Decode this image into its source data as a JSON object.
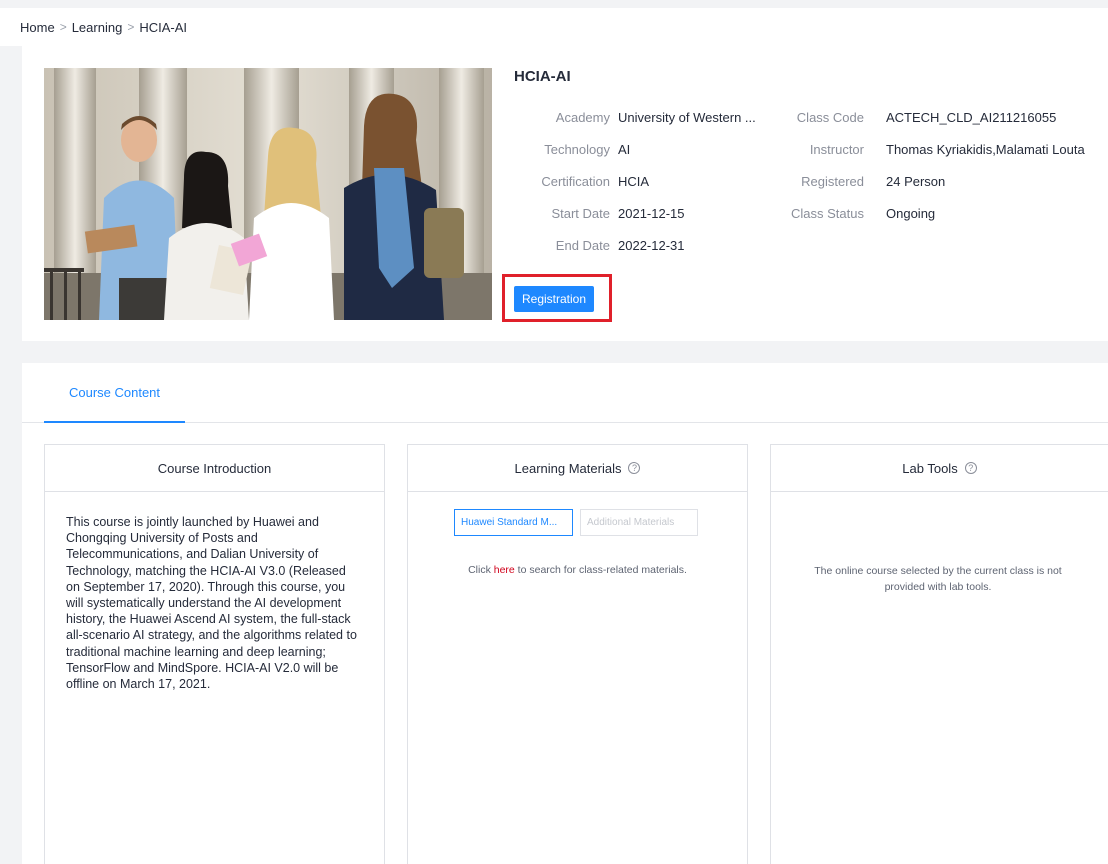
{
  "breadcrumb": {
    "items": [
      "Home",
      "Learning",
      "HCIA-AI"
    ],
    "separator": ">"
  },
  "course": {
    "title": "HCIA-AI",
    "fields": {
      "academy": {
        "label": "Academy",
        "value": "University of Western ..."
      },
      "technology": {
        "label": "Technology",
        "value": "AI"
      },
      "certification": {
        "label": "Certification",
        "value": "HCIA"
      },
      "start_date": {
        "label": "Start Date",
        "value": "2021-12-15"
      },
      "end_date": {
        "label": "End Date",
        "value": "2022-12-31"
      },
      "class_code": {
        "label": "Class Code",
        "value": "ACTECH_CLD_AI211216055"
      },
      "instructor": {
        "label": "Instructor",
        "value": "Thomas Kyriakidis,Malamati Louta"
      },
      "registered": {
        "label": "Registered",
        "value": "24 Person"
      },
      "class_status": {
        "label": "Class Status",
        "value": "Ongoing"
      }
    },
    "registration_label": "Registration"
  },
  "tabs": {
    "course_content": "Course Content"
  },
  "panels": {
    "intro": {
      "title": "Course Introduction",
      "text": "This course is jointly launched by Huawei and Chongqing University of Posts and Telecommunications, and Dalian University of Technology, matching the HCIA-AI V3.0 (Released on September 17, 2020). Through this course, you will systematically understand the AI development history, the Huawei Ascend AI system, the full-stack all-scenario AI strategy, and the algorithms related to traditional machine learning and deep learning; TensorFlow and MindSpore. HCIA-AI V2.0 will be offline on March 17, 2021."
    },
    "materials": {
      "title": "Learning Materials",
      "btn_standard": "Huawei Standard M...",
      "btn_additional": "Additional Materials",
      "hint_before": "Click ",
      "hint_link": "here",
      "hint_after": " to search for class-related materials."
    },
    "lab": {
      "title": "Lab Tools",
      "text": "The online course selected by the current class is not provided with lab tools."
    },
    "help_glyph": "?"
  },
  "colors": {
    "accent": "#1e88ff",
    "highlight_box": "#e0202a",
    "link": "#d0021b"
  },
  "icons": [
    "chevron-right-icon",
    "help-circle-icon"
  ]
}
